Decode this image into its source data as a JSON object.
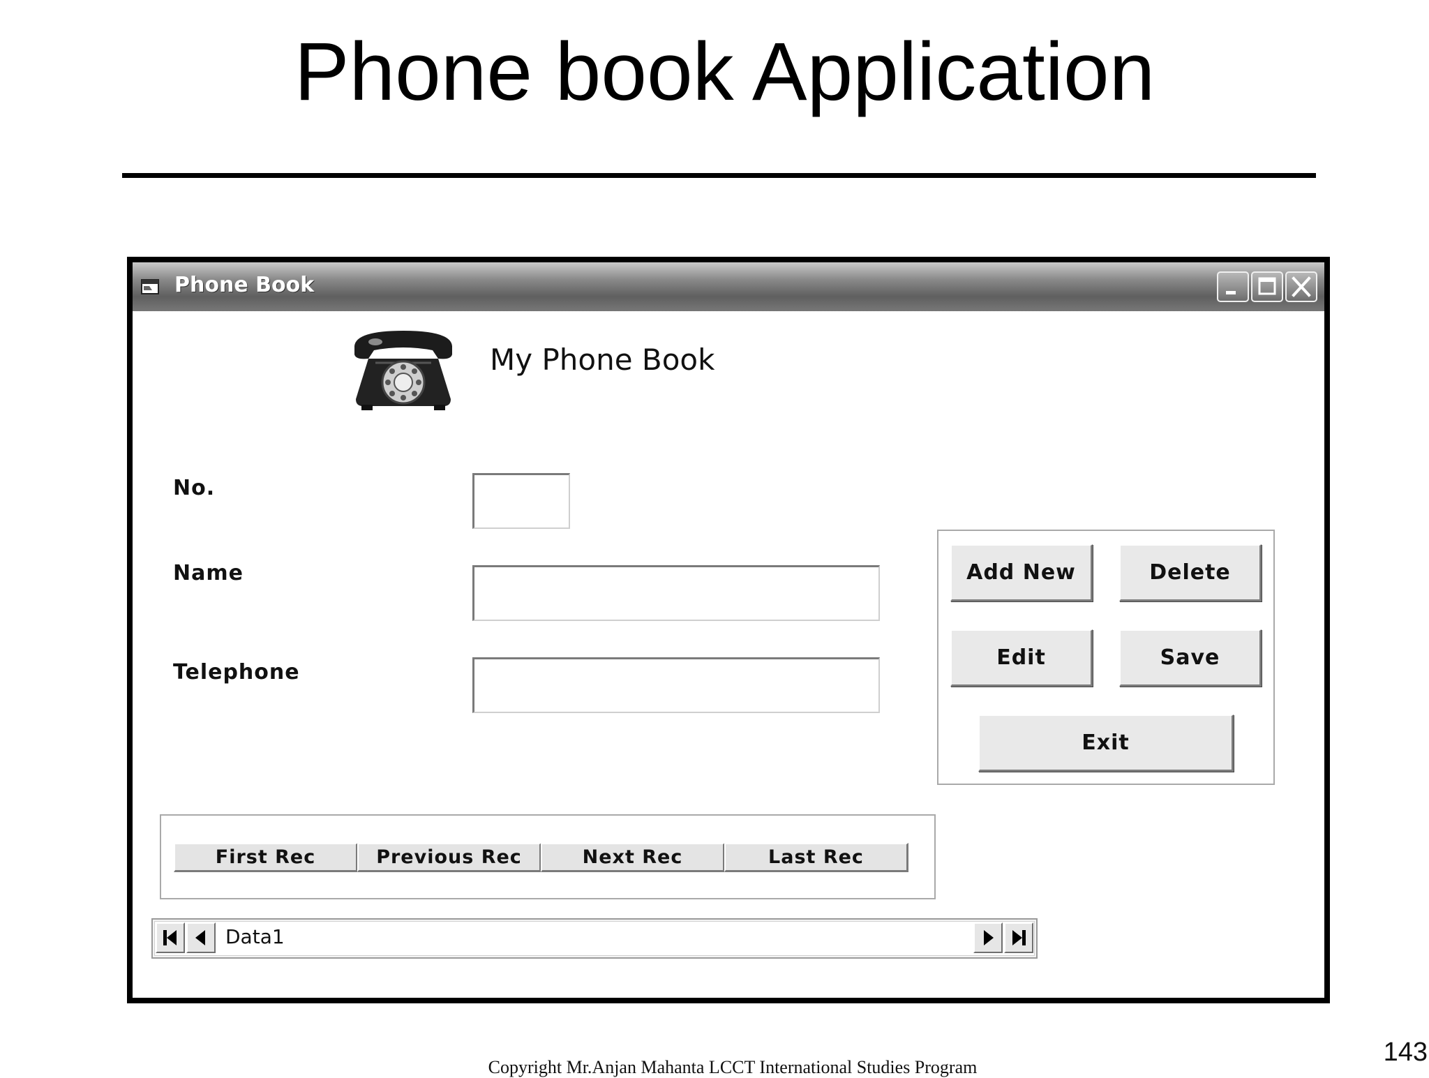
{
  "slide": {
    "title": "Phone book Application",
    "page_number": "143",
    "copyright": "Copyright Mr.Anjan Mahanta LCCT International Studies Program"
  },
  "window": {
    "title": "Phone Book",
    "controls": [
      "minimize-icon",
      "maximize-icon",
      "close-icon"
    ]
  },
  "header": {
    "heading": "My Phone Book",
    "icon": "telephone-icon"
  },
  "form": {
    "no_label": "No.",
    "no_value": "",
    "name_label": "Name",
    "name_value": "",
    "telephone_label": "Telephone",
    "telephone_value": ""
  },
  "actions": {
    "add_new": "Add New",
    "delete": "Delete",
    "edit": "Edit",
    "save": "Save",
    "exit": "Exit"
  },
  "navigation": {
    "first": "First Rec",
    "previous": "Previous Rec",
    "next": "Next Rec",
    "last": "Last Rec"
  },
  "data_control": {
    "caption": "Data1",
    "buttons": [
      "first-record-icon",
      "previous-record-icon",
      "next-record-icon",
      "last-record-icon"
    ]
  }
}
